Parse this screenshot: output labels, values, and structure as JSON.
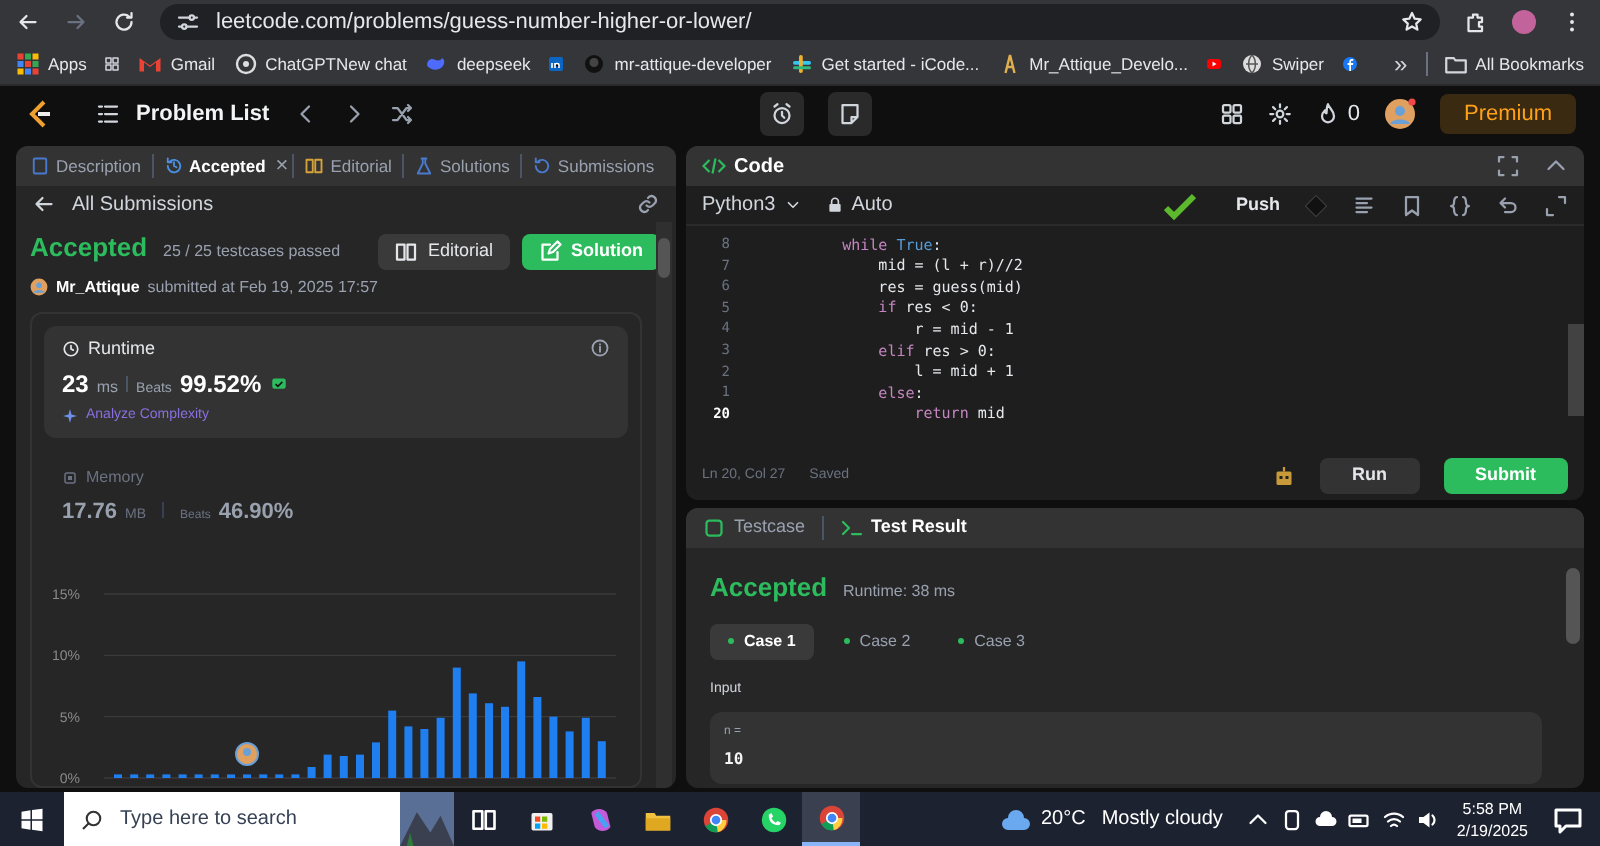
{
  "browser": {
    "url": "leetcode.com/problems/guess-number-higher-or-lower/",
    "bookmarks": [
      {
        "label": "Apps"
      },
      {
        "label": "Gmail"
      },
      {
        "label": "ChatGPTNew chat"
      },
      {
        "label": "deepseek"
      },
      {
        "label": "mr-attique-developer"
      },
      {
        "label": "Get started - iCode..."
      },
      {
        "label": "Mr_Attique_Develo..."
      },
      {
        "label": "Swiper"
      }
    ],
    "more": "»",
    "all_bookmarks": "All Bookmarks"
  },
  "nav": {
    "title": "Problem List",
    "streak": "0",
    "premium": "Premium"
  },
  "left_tabs": [
    {
      "label": "Description",
      "selected": false
    },
    {
      "label": "Accepted",
      "selected": true,
      "close": "×"
    },
    {
      "label": "Editorial",
      "selected": false
    },
    {
      "label": "Solutions",
      "selected": false
    },
    {
      "label": "Submissions",
      "selected": false
    }
  ],
  "back_link": "All Submissions",
  "submission": {
    "status": "Accepted",
    "testcases": "25 / 25 testcases passed",
    "user": "Mr_Attique",
    "submitted": "submitted at Feb 19, 2025 17:57",
    "buttons": [
      {
        "label": "Editorial",
        "kind": "secondary"
      },
      {
        "label": "Solution",
        "kind": "primary"
      }
    ]
  },
  "runtime": {
    "title": "Runtime",
    "value": "23",
    "unit": "ms",
    "beats_label": "Beats",
    "beats": "99.52%",
    "analyze": "Analyze Complexity"
  },
  "memory": {
    "title": "Memory",
    "value": "17.76",
    "unit": "MB",
    "beats_label": "Beats",
    "beats": "46.90%"
  },
  "distribution": {
    "chart_data": {
      "type": "bar",
      "ylim": [
        0,
        15
      ],
      "yticks": [
        {
          "value": 0,
          "label": "0%"
        },
        {
          "value": 5,
          "label": "5%"
        },
        {
          "value": 10,
          "label": "10%"
        },
        {
          "value": 15,
          "label": "15%"
        }
      ],
      "series": [
        {
          "color": "#1f7ef0",
          "values": [
            0.3,
            0.3,
            0.3,
            0.3,
            0.3,
            0.3,
            0.3,
            0.3,
            0.3,
            0.3,
            0.3,
            0.3,
            0.9,
            1.9,
            1.8,
            1.9,
            2.9,
            5.5,
            4.2,
            4.0,
            4.9,
            9.0,
            6.9,
            6.1,
            5.8,
            9.5,
            6.6,
            5.0,
            3.8,
            4.9,
            3.0
          ]
        }
      ]
    }
  },
  "code": {
    "title": "Code",
    "language": "Python3",
    "mode": "Auto",
    "push": "Push",
    "lines": [
      {
        "number": "8",
        "current": false,
        "segments": [
          {
            "text": "        while",
            "kind": "keyword"
          },
          {
            "text": " True",
            "kind": "constant"
          },
          {
            "text": ":"
          }
        ]
      },
      {
        "number": "7",
        "current": false,
        "segments": [
          {
            "text": "            mid = (l + r)//2"
          }
        ]
      },
      {
        "number": "6",
        "current": false,
        "segments": [
          {
            "text": "            res = guess(mid)"
          }
        ]
      },
      {
        "number": "5",
        "current": false,
        "segments": [
          {
            "text": "            if",
            "kind": "keyword"
          },
          {
            "text": " res < 0:"
          }
        ]
      },
      {
        "number": "4",
        "current": false,
        "segments": [
          {
            "text": "                r = mid - 1"
          }
        ]
      },
      {
        "number": "3",
        "current": false,
        "segments": [
          {
            "text": "            elif",
            "kind": "keyword"
          },
          {
            "text": " res > 0:"
          }
        ]
      },
      {
        "number": "2",
        "current": false,
        "segments": [
          {
            "text": "                l = mid + 1"
          }
        ]
      },
      {
        "number": "1",
        "current": false,
        "segments": [
          {
            "text": "            else",
            "kind": "keyword"
          },
          {
            "text": ":"
          }
        ]
      },
      {
        "number": "20",
        "current": true,
        "segments": [
          {
            "text": "                return",
            "kind": "keyword"
          },
          {
            "text": " mid"
          }
        ]
      }
    ],
    "position": "Ln 20, Col 27",
    "saved": "Saved",
    "run": "Run",
    "submit": "Submit"
  },
  "test": {
    "tabs": [
      {
        "label": "Testcase",
        "selected": false
      },
      {
        "label": "Test Result",
        "selected": true
      }
    ],
    "status": "Accepted",
    "runtime": "Runtime: 38 ms",
    "cases": [
      {
        "label": "Case 1",
        "selected": true,
        "passed": true
      },
      {
        "label": "Case 2",
        "selected": false,
        "passed": true
      },
      {
        "label": "Case 3",
        "selected": false,
        "passed": true
      }
    ],
    "input_label": "Input",
    "variable": "n =",
    "value": "10"
  },
  "taskbar": {
    "search_placeholder": "Type here to search",
    "temperature": "20°C",
    "weather": "Mostly cloudy",
    "time": "5:58 PM",
    "date": "2/19/2025"
  }
}
